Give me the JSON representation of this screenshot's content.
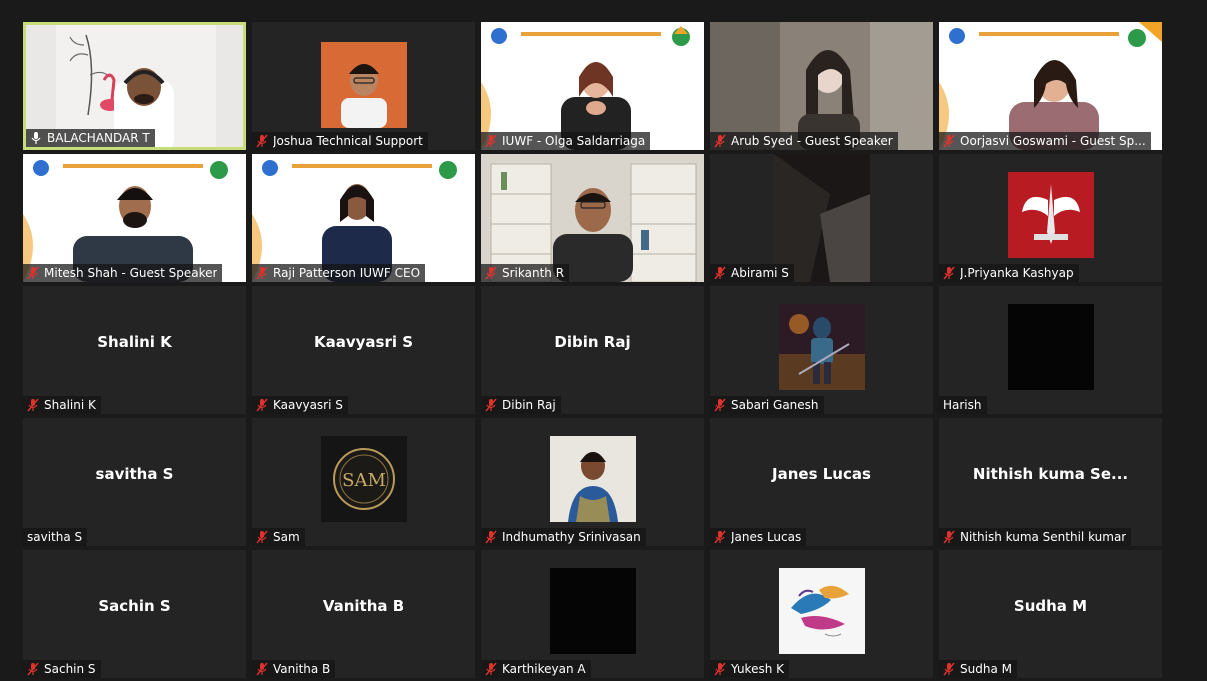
{
  "participants": [
    {
      "name": "BALACHANDAR T",
      "muted": false,
      "speaking": true,
      "display": "video"
    },
    {
      "name": "Joshua Technical Support",
      "muted": true,
      "display": "video"
    },
    {
      "name": "IUWF - Olga Saldarriaga",
      "muted": true,
      "display": "video"
    },
    {
      "name": "Arub Syed - Guest Speaker",
      "muted": true,
      "display": "video"
    },
    {
      "name": "Oorjasvi Goswami - Guest Sp...",
      "muted": true,
      "display": "video"
    },
    {
      "name": "Mitesh Shah - Guest Speaker",
      "muted": true,
      "display": "video"
    },
    {
      "name": "Raji Patterson IUWF CEO",
      "muted": true,
      "display": "video"
    },
    {
      "name": "Srikanth R",
      "muted": true,
      "display": "video"
    },
    {
      "name": "Abirami S",
      "muted": true,
      "display": "video"
    },
    {
      "name": "J.Priyanka Kashyap",
      "muted": true,
      "display": "avatar"
    },
    {
      "name": "Shalini K",
      "muted": true,
      "display": "name",
      "center": "Shalini K"
    },
    {
      "name": "Kaavyasri S",
      "muted": true,
      "display": "name",
      "center": "Kaavyasri S"
    },
    {
      "name": "Dibin Raj",
      "muted": true,
      "display": "name",
      "center": "Dibin Raj"
    },
    {
      "name": "Sabari Ganesh",
      "muted": true,
      "display": "avatar"
    },
    {
      "name": "Harish",
      "muted": false,
      "display": "avatar"
    },
    {
      "name": "savitha S",
      "muted": false,
      "display": "name",
      "center": "savitha S"
    },
    {
      "name": "Sam",
      "muted": true,
      "display": "avatar",
      "logo_text": "SAM"
    },
    {
      "name": "Indhumathy Srinivasan",
      "muted": true,
      "display": "avatar"
    },
    {
      "name": "Janes Lucas",
      "muted": true,
      "display": "name",
      "center": "Janes Lucas"
    },
    {
      "name": "Nithish kuma Senthil kumar",
      "muted": true,
      "display": "name",
      "center": "Nithish kuma Se..."
    },
    {
      "name": "Sachin S",
      "muted": true,
      "display": "name",
      "center": "Sachin S"
    },
    {
      "name": "Vanitha B",
      "muted": true,
      "display": "name",
      "center": "Vanitha B"
    },
    {
      "name": "Karthikeyan A",
      "muted": true,
      "display": "avatar"
    },
    {
      "name": "Yukesh K",
      "muted": true,
      "display": "avatar"
    },
    {
      "name": "Sudha M",
      "muted": true,
      "display": "name",
      "center": "Sudha M"
    }
  ],
  "colors": {
    "background": "#1a1a1a",
    "tile": "#242424",
    "active_speaker_border": "#c8dc7a",
    "muted_icon": "#e0322c"
  },
  "icons": {
    "muted": "mic-muted-icon",
    "speaking": "mic-active-icon"
  }
}
